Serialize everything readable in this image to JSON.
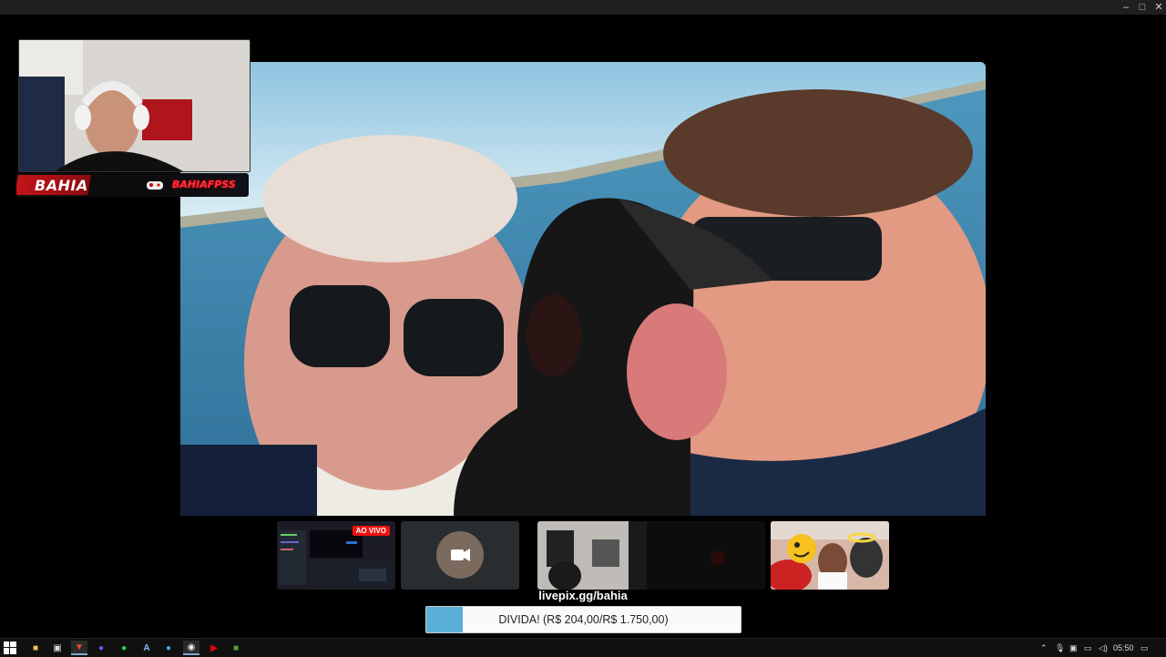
{
  "window": {
    "controls": {
      "minimize": "–",
      "maximize": "□",
      "close": "✕"
    }
  },
  "stream": {
    "overlay_left": "BAHIA",
    "overlay_right": "BAHIAFPSS",
    "donation_link": "livepix.gg/bahia",
    "goal": {
      "label": "DIVIDA! (R$ 204,00/R$ 1.750,00)",
      "current": 204,
      "target": 1750
    },
    "thumbs": [
      {
        "name": "obs-screen",
        "badge": "AO VIVO"
      },
      {
        "name": "camera-off"
      },
      {
        "name": "room-cam"
      },
      {
        "name": "dark-scene"
      },
      {
        "name": "meme-photo"
      }
    ]
  },
  "taskbar": {
    "apps": [
      "start",
      "file-explorer",
      "store",
      "brave",
      "discord",
      "spotify",
      "app-a",
      "edge",
      "obs",
      "youtube",
      "minecraft"
    ],
    "clock": "05:50"
  }
}
